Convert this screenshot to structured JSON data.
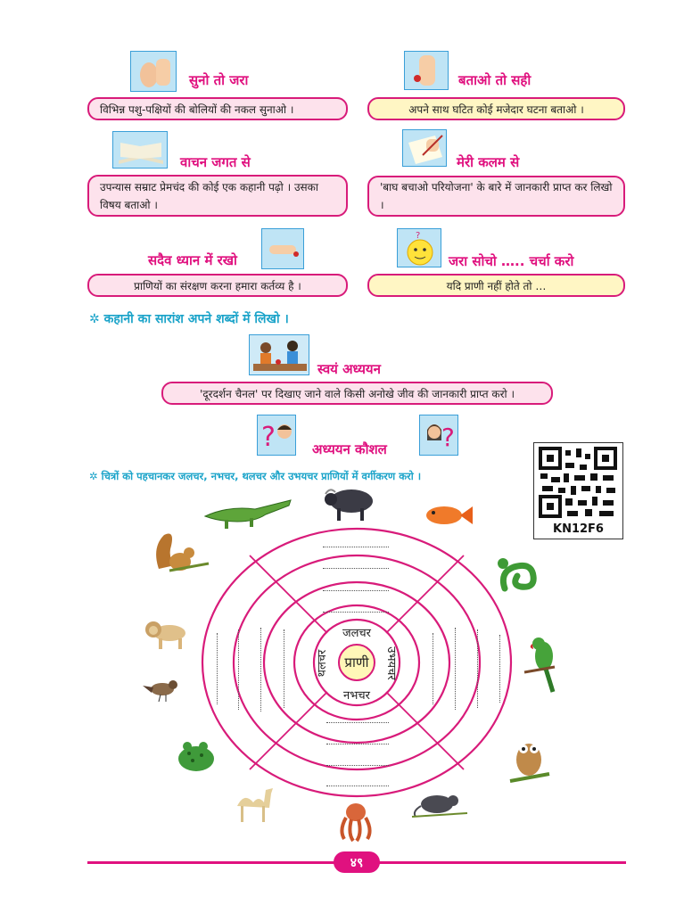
{
  "sections": {
    "listen": {
      "title": "सुनो तो जरा",
      "text": "विभिन्न पशु-पक्षियों की बोलियों की नकल सुनाओ ।"
    },
    "tell": {
      "title": "बताओ तो सही",
      "text": "अपने साथ घटित कोई मजेदार घटना बताओ ।"
    },
    "read": {
      "title": "वाचन जगत से",
      "text": "उपन्यास सम्राट प्रेमचंद की कोई एक कहानी पढ़ो । उसका विषय बताओ ।"
    },
    "pen": {
      "title": "मेरी कलम से",
      "text": "'बाघ बचाओ परियोजना' के बारे में जानकारी प्राप्त कर लिखो ।"
    },
    "remember": {
      "title": "सदैव ध्यान में रखो",
      "text": "प्राणियों का संरक्षण करना हमारा कर्तव्य है ।"
    },
    "think": {
      "title": "जरा सोचो ….. चर्चा करो",
      "text": "यदि प्राणी नहीं होते तो …"
    }
  },
  "summary_task": "✲ कहानी का सारांश अपने शब्दों में लिखो ।",
  "self_study": {
    "title": "स्वयं अध्ययन",
    "text": "'दूरदर्शन चैनल' पर दिखाए जाने वाले किसी अनोखे जीव की जानकारी प्राप्त करो ।"
  },
  "study_skill": {
    "title": "अध्ययन कौशल"
  },
  "classify_task": "✲ चित्रों को पहचानकर जलचर, नभचर, थलचर और उभयचर प्राणियों में वर्गीकरण करो ।",
  "qr_code": "KN12F6",
  "diagram": {
    "center": "प्राणी",
    "top": "जलचर",
    "bottom": "नभचर",
    "left": "थलचर",
    "right": "उभयचर"
  },
  "animals": [
    "crocodile-icon",
    "buffalo-icon",
    "fish-icon",
    "squirrel-icon",
    "snake-icon",
    "lion-icon",
    "parrot-icon",
    "sparrow-icon",
    "owl-icon",
    "frog-icon",
    "camel-icon",
    "octopus-icon",
    "rat-icon"
  ],
  "page_number": "४९",
  "colors": {
    "accent": "#e0117f",
    "cyan": "#1aa3c9",
    "ring": "#d81b7a"
  }
}
